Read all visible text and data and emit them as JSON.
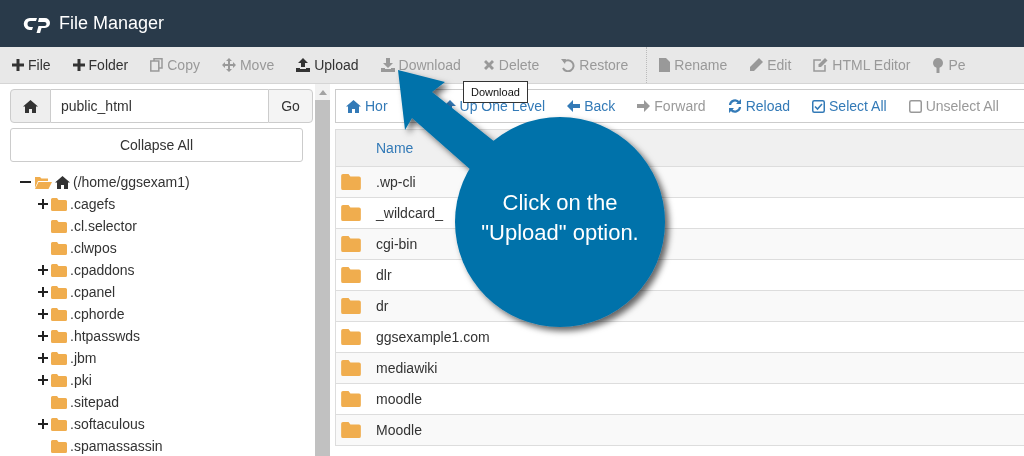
{
  "header": {
    "title": "File Manager"
  },
  "toolbar": {
    "groups": [
      [
        {
          "label": "File",
          "disabled": false
        },
        {
          "label": "Folder",
          "disabled": false
        },
        {
          "label": "Copy",
          "disabled": true
        },
        {
          "label": "Move",
          "disabled": true
        },
        {
          "label": "Upload",
          "disabled": false
        },
        {
          "label": "Download",
          "disabled": true
        },
        {
          "label": "Delete",
          "disabled": true
        },
        {
          "label": "Restore",
          "disabled": true
        }
      ],
      [
        {
          "label": "Rename",
          "disabled": true
        },
        {
          "label": "Edit",
          "disabled": true
        },
        {
          "label": "HTML Editor",
          "disabled": true
        },
        {
          "label": "Pe",
          "disabled": true
        }
      ]
    ]
  },
  "tooltip": {
    "text": "Download"
  },
  "path_bar": {
    "value": "public_html",
    "button": "Go"
  },
  "collapse_button": "Collapse All",
  "tree": {
    "label": "(/home/ggsexam1)",
    "expanded": true,
    "children": [
      {
        "label": ".cagefs",
        "expandable": true
      },
      {
        "label": ".cl.selector",
        "expandable": false
      },
      {
        "label": ".clwpos",
        "expandable": false
      },
      {
        "label": ".cpaddons",
        "expandable": true
      },
      {
        "label": ".cpanel",
        "expandable": true
      },
      {
        "label": ".cphorde",
        "expandable": true
      },
      {
        "label": ".htpasswds",
        "expandable": true
      },
      {
        "label": ".jbm",
        "expandable": true
      },
      {
        "label": ".pki",
        "expandable": true
      },
      {
        "label": ".sitepad",
        "expandable": false
      },
      {
        "label": ".softaculous",
        "expandable": true
      },
      {
        "label": ".spamassassin",
        "expandable": false
      }
    ]
  },
  "nav": [
    {
      "label": "Hor",
      "disabled": false
    },
    {
      "label": "Up One Level",
      "disabled": false
    },
    {
      "label": "Back",
      "disabled": false
    },
    {
      "label": "Forward",
      "disabled": true
    },
    {
      "label": "Reload",
      "disabled": false
    },
    {
      "label": "Select All",
      "disabled": false
    },
    {
      "label": "Unselect All",
      "disabled": true
    }
  ],
  "table": {
    "columns": [
      "Name"
    ],
    "rows": [
      {
        "name": ".wp-cli"
      },
      {
        "name": "_wildcard_"
      },
      {
        "name": "cgi-bin"
      },
      {
        "name": "dlr"
      },
      {
        "name": "dr"
      },
      {
        "name": "ggsexample1.com"
      },
      {
        "name": "mediawiki"
      },
      {
        "name": "moodle"
      },
      {
        "name": "Moodle"
      }
    ]
  },
  "callout": {
    "lines": [
      "Click on the",
      "\"Upload\" option."
    ]
  }
}
